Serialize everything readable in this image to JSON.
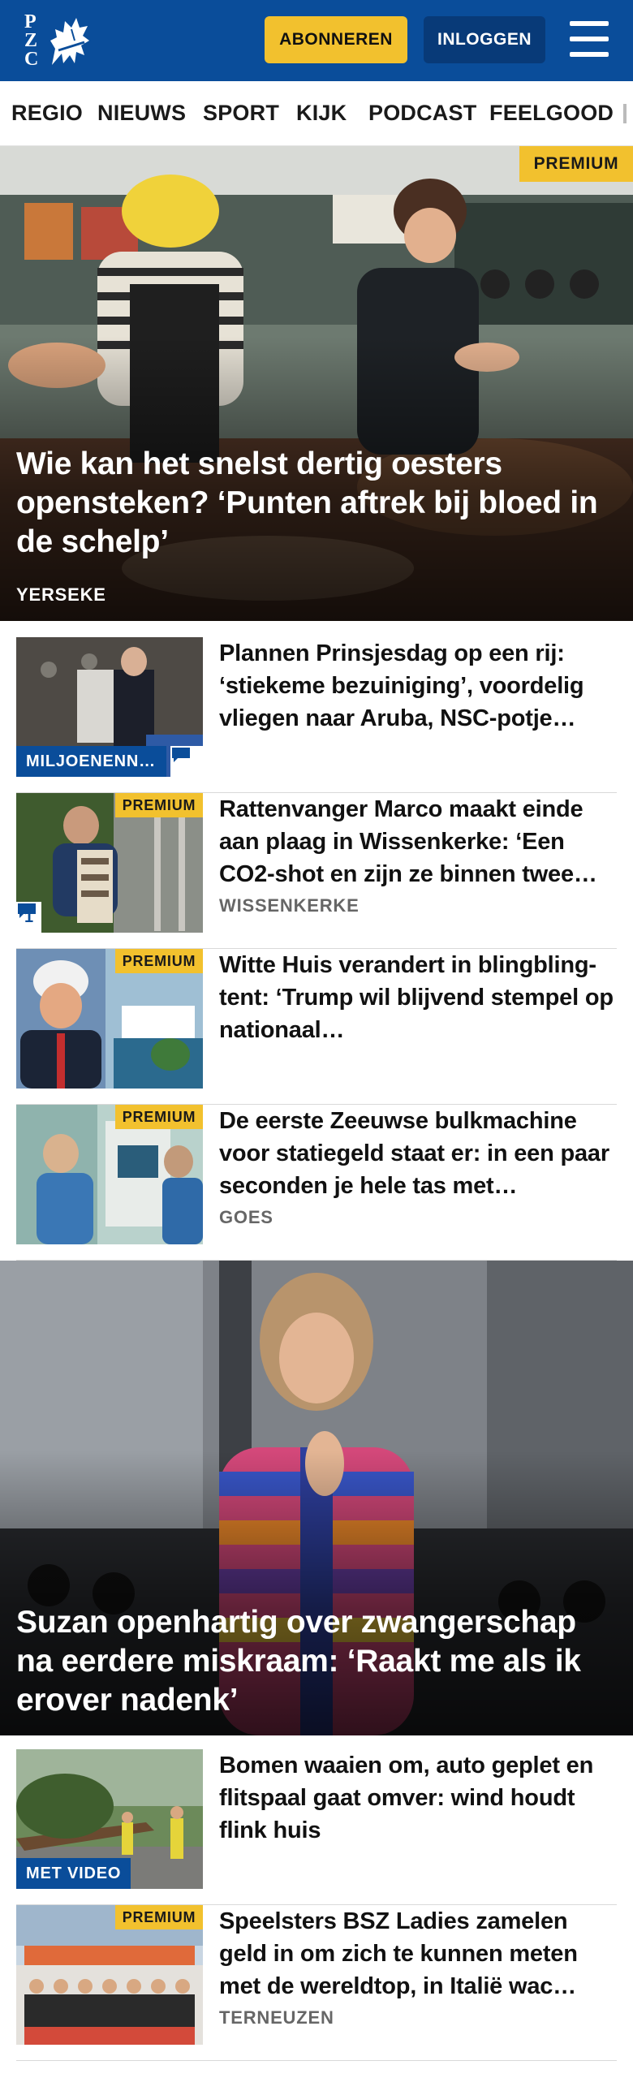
{
  "header": {
    "logo_letters": [
      "P",
      "Z",
      "C"
    ],
    "subscribe_label": "ABONNEREN",
    "login_label": "INLOGGEN",
    "menu_icon": "hamburger-menu-icon"
  },
  "nav": {
    "items": [
      "REGIO",
      "NIEUWS",
      "SPORT",
      "KIJK",
      "PODCAST",
      "FEELGOOD"
    ]
  },
  "hero_1": {
    "badge": "PREMIUM",
    "title": "Wie kan het snelst dertig oesters opensteken? ‘Punten aftrek bij bloed in de schelp’",
    "kicker": "YERSEKE"
  },
  "articles_1": [
    {
      "title": "Plannen Prinsjesdag op een rij: ‘stiekeme bezuiniging’, voordelig vliegen naar Aruba, NSC-potje…",
      "tag": "MILJOENENN…",
      "comment_icon": "comment-icon"
    },
    {
      "title": "Rattenvanger Marco maakt einde aan plaag in Wissenkerke: ‘Een CO2-shot en zijn ze binnen twee…",
      "badge": "PREMIUM",
      "comments": "1",
      "kicker": "WISSENKERKE"
    },
    {
      "title": "Witte Huis verandert in blingbling-tent: ‘Trump wil blijvend stempel op nationaal…",
      "badge": "PREMIUM"
    },
    {
      "title": "De eerste Zeeuwse bulkmachine voor statiegeld staat er: in een paar seconden je hele tas met…",
      "badge": "PREMIUM",
      "kicker": "GOES"
    }
  ],
  "hero_2": {
    "title": "Suzan openhartig over zwangerschap na eerdere miskraam: ‘Raakt me als ik erover nadenk’"
  },
  "articles_2": [
    {
      "title": "Bomen waaien om, auto geplet en flitspaal gaat omver: wind houdt flink huis",
      "tag": "MET VIDEO"
    },
    {
      "title": "Speelsters BSZ Ladies zamelen geld in om zich te kunnen meten met de wereldtop, in Italië wac…",
      "badge": "PREMIUM",
      "kicker": "TERNEUZEN"
    }
  ],
  "colors": {
    "brand_blue": "#0a4d9a",
    "premium_yellow": "#f2c12e",
    "login_blue": "#083a78"
  }
}
